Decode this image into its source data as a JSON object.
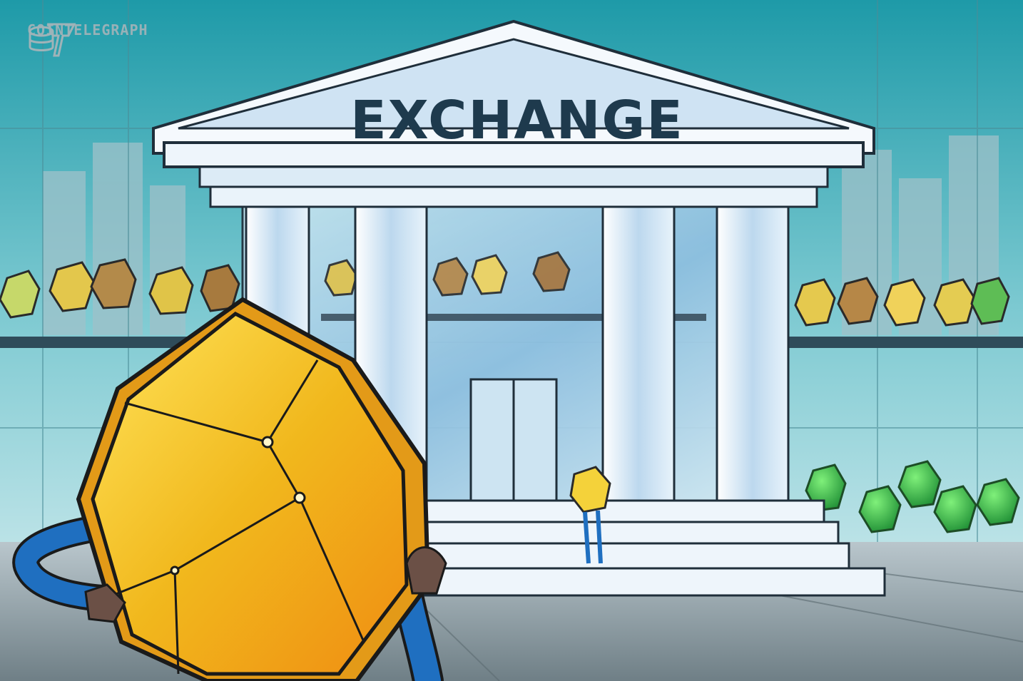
{
  "brand": {
    "name": "COINTELEGRAPH",
    "logo_icon": "cointelegraph-logo-icon"
  },
  "building": {
    "sign": "EXCHANGE"
  },
  "colors": {
    "sky_top": "#2fa2b0",
    "sky_bottom": "#d8eef2",
    "sign_text": "#1e3a4d",
    "coin_gold": "#f1c232",
    "coin_green": "#3fbf4b",
    "arm_blue": "#1f6fc0"
  }
}
